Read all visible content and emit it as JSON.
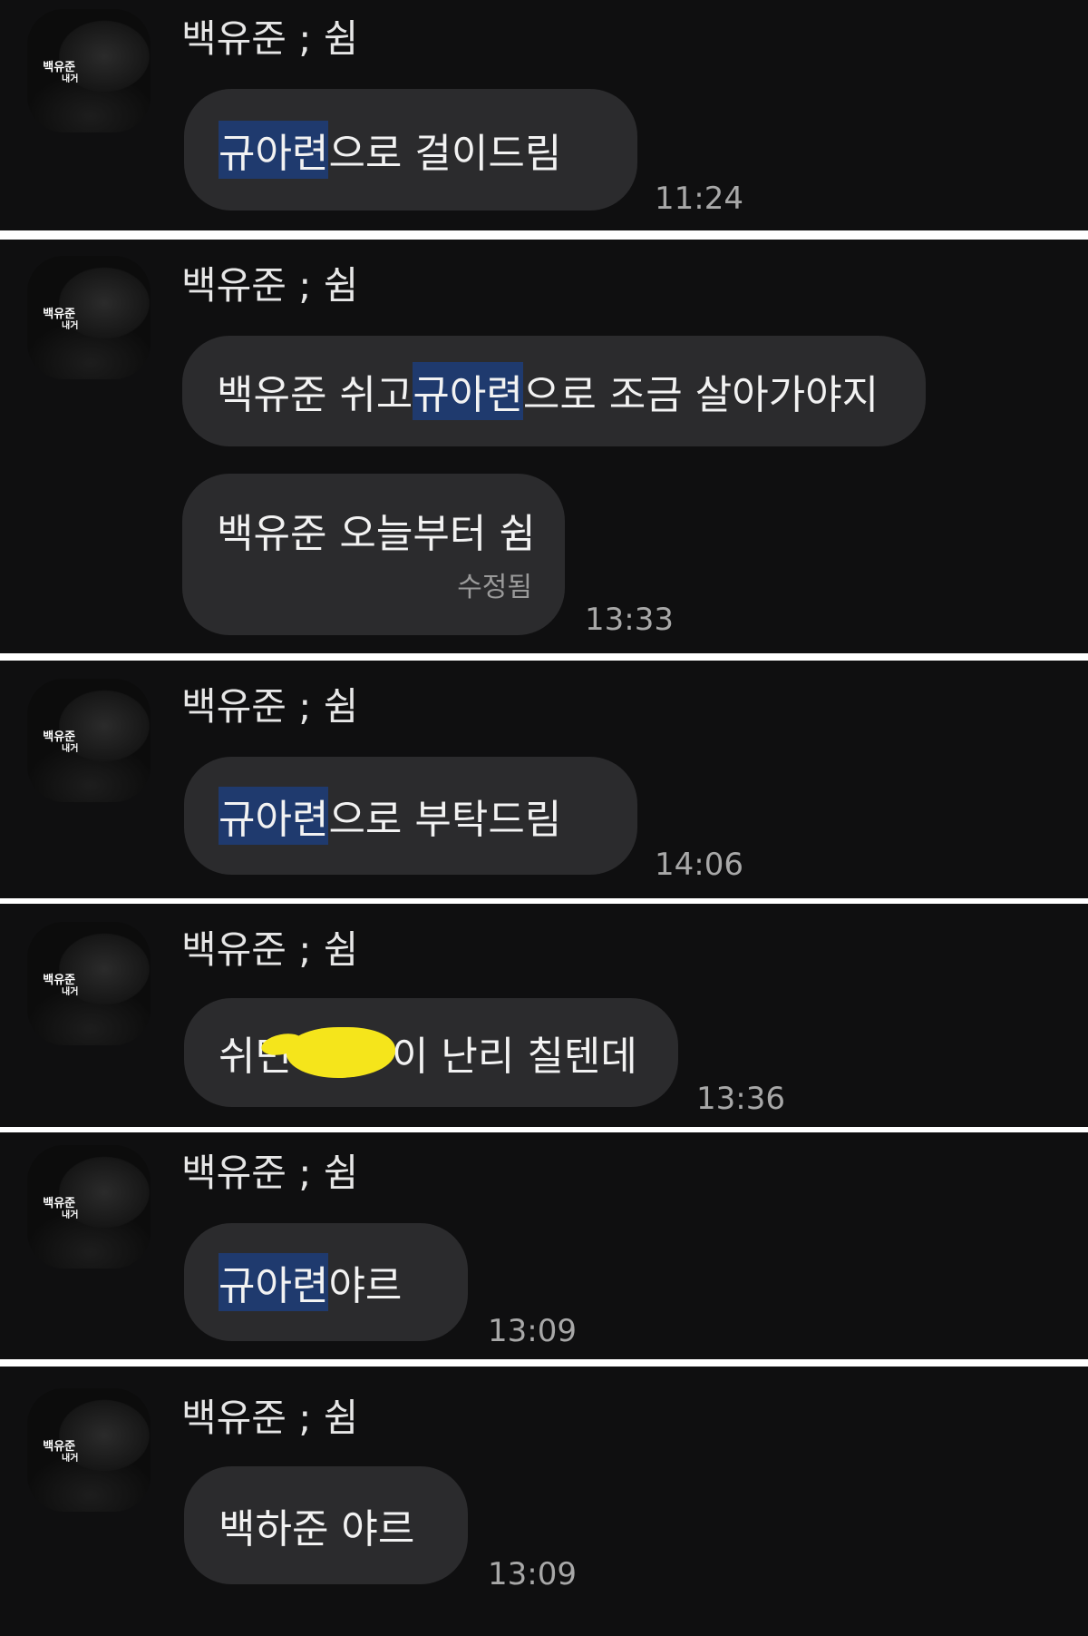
{
  "panels": [
    {
      "avatar_caption": [
        "백유준",
        "내거"
      ],
      "sender": "백유준 ; 쉼",
      "messages": [
        {
          "highlight": "규아련",
          "text": "으로 걸이드림"
        }
      ],
      "time": "11:24"
    },
    {
      "avatar_caption": [
        "백유준",
        "내거"
      ],
      "sender": "백유준 ; 쉼",
      "messages": [
        {
          "pre": "백유준 쉬고 ",
          "highlight": "규아련",
          "text": "으로 조금 살아가야지"
        },
        {
          "text": "백유준 오늘부터 쉼",
          "edited": "수정됨"
        }
      ],
      "time": "13:33"
    },
    {
      "avatar_caption": [
        "백유준",
        "내거"
      ],
      "sender": "백유준 ; 쉼",
      "messages": [
        {
          "highlight": "규아련",
          "text": "으로 부탁드림"
        }
      ],
      "time": "14:06"
    },
    {
      "avatar_caption": [
        "백유준",
        "내거"
      ],
      "sender": "백유준 ; 쉼",
      "messages": [
        {
          "pre": "쉬면",
          "text": "이 난리 칠텐데"
        }
      ],
      "time": "13:36"
    },
    {
      "avatar_caption": [
        "백유준",
        "내거"
      ],
      "sender": "백유준 ; 쉼",
      "messages": [
        {
          "highlight": "규아련",
          "text": " 야르"
        }
      ],
      "time": "13:09"
    },
    {
      "avatar_caption": [
        "백유준",
        "내거"
      ],
      "sender": "백유준 ; 쉼",
      "messages": [
        {
          "text": "백하준 야르"
        }
      ],
      "time": "13:09"
    }
  ]
}
